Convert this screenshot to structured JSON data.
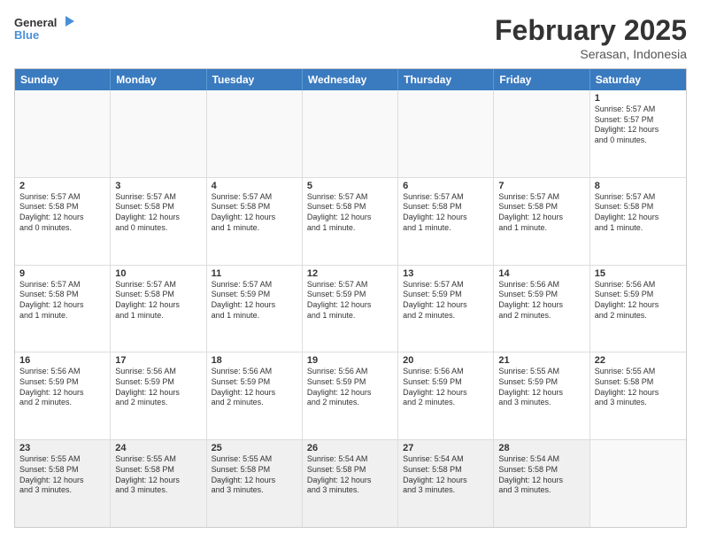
{
  "logo": {
    "line1": "General",
    "line2": "Blue"
  },
  "title": "February 2025",
  "subtitle": "Serasan, Indonesia",
  "header_days": [
    "Sunday",
    "Monday",
    "Tuesday",
    "Wednesday",
    "Thursday",
    "Friday",
    "Saturday"
  ],
  "rows": [
    [
      {
        "day": "",
        "text": "",
        "empty": true
      },
      {
        "day": "",
        "text": "",
        "empty": true
      },
      {
        "day": "",
        "text": "",
        "empty": true
      },
      {
        "day": "",
        "text": "",
        "empty": true
      },
      {
        "day": "",
        "text": "",
        "empty": true
      },
      {
        "day": "",
        "text": "",
        "empty": true
      },
      {
        "day": "1",
        "text": "Sunrise: 5:57 AM\nSunset: 5:57 PM\nDaylight: 12 hours\nand 0 minutes.",
        "empty": false
      }
    ],
    [
      {
        "day": "2",
        "text": "Sunrise: 5:57 AM\nSunset: 5:58 PM\nDaylight: 12 hours\nand 0 minutes.",
        "empty": false
      },
      {
        "day": "3",
        "text": "Sunrise: 5:57 AM\nSunset: 5:58 PM\nDaylight: 12 hours\nand 0 minutes.",
        "empty": false
      },
      {
        "day": "4",
        "text": "Sunrise: 5:57 AM\nSunset: 5:58 PM\nDaylight: 12 hours\nand 1 minute.",
        "empty": false
      },
      {
        "day": "5",
        "text": "Sunrise: 5:57 AM\nSunset: 5:58 PM\nDaylight: 12 hours\nand 1 minute.",
        "empty": false
      },
      {
        "day": "6",
        "text": "Sunrise: 5:57 AM\nSunset: 5:58 PM\nDaylight: 12 hours\nand 1 minute.",
        "empty": false
      },
      {
        "day": "7",
        "text": "Sunrise: 5:57 AM\nSunset: 5:58 PM\nDaylight: 12 hours\nand 1 minute.",
        "empty": false
      },
      {
        "day": "8",
        "text": "Sunrise: 5:57 AM\nSunset: 5:58 PM\nDaylight: 12 hours\nand 1 minute.",
        "empty": false
      }
    ],
    [
      {
        "day": "9",
        "text": "Sunrise: 5:57 AM\nSunset: 5:58 PM\nDaylight: 12 hours\nand 1 minute.",
        "empty": false
      },
      {
        "day": "10",
        "text": "Sunrise: 5:57 AM\nSunset: 5:58 PM\nDaylight: 12 hours\nand 1 minute.",
        "empty": false
      },
      {
        "day": "11",
        "text": "Sunrise: 5:57 AM\nSunset: 5:59 PM\nDaylight: 12 hours\nand 1 minute.",
        "empty": false
      },
      {
        "day": "12",
        "text": "Sunrise: 5:57 AM\nSunset: 5:59 PM\nDaylight: 12 hours\nand 1 minute.",
        "empty": false
      },
      {
        "day": "13",
        "text": "Sunrise: 5:57 AM\nSunset: 5:59 PM\nDaylight: 12 hours\nand 2 minutes.",
        "empty": false
      },
      {
        "day": "14",
        "text": "Sunrise: 5:56 AM\nSunset: 5:59 PM\nDaylight: 12 hours\nand 2 minutes.",
        "empty": false
      },
      {
        "day": "15",
        "text": "Sunrise: 5:56 AM\nSunset: 5:59 PM\nDaylight: 12 hours\nand 2 minutes.",
        "empty": false
      }
    ],
    [
      {
        "day": "16",
        "text": "Sunrise: 5:56 AM\nSunset: 5:59 PM\nDaylight: 12 hours\nand 2 minutes.",
        "empty": false
      },
      {
        "day": "17",
        "text": "Sunrise: 5:56 AM\nSunset: 5:59 PM\nDaylight: 12 hours\nand 2 minutes.",
        "empty": false
      },
      {
        "day": "18",
        "text": "Sunrise: 5:56 AM\nSunset: 5:59 PM\nDaylight: 12 hours\nand 2 minutes.",
        "empty": false
      },
      {
        "day": "19",
        "text": "Sunrise: 5:56 AM\nSunset: 5:59 PM\nDaylight: 12 hours\nand 2 minutes.",
        "empty": false
      },
      {
        "day": "20",
        "text": "Sunrise: 5:56 AM\nSunset: 5:59 PM\nDaylight: 12 hours\nand 2 minutes.",
        "empty": false
      },
      {
        "day": "21",
        "text": "Sunrise: 5:55 AM\nSunset: 5:59 PM\nDaylight: 12 hours\nand 3 minutes.",
        "empty": false
      },
      {
        "day": "22",
        "text": "Sunrise: 5:55 AM\nSunset: 5:58 PM\nDaylight: 12 hours\nand 3 minutes.",
        "empty": false
      }
    ],
    [
      {
        "day": "23",
        "text": "Sunrise: 5:55 AM\nSunset: 5:58 PM\nDaylight: 12 hours\nand 3 minutes.",
        "empty": false
      },
      {
        "day": "24",
        "text": "Sunrise: 5:55 AM\nSunset: 5:58 PM\nDaylight: 12 hours\nand 3 minutes.",
        "empty": false
      },
      {
        "day": "25",
        "text": "Sunrise: 5:55 AM\nSunset: 5:58 PM\nDaylight: 12 hours\nand 3 minutes.",
        "empty": false
      },
      {
        "day": "26",
        "text": "Sunrise: 5:54 AM\nSunset: 5:58 PM\nDaylight: 12 hours\nand 3 minutes.",
        "empty": false
      },
      {
        "day": "27",
        "text": "Sunrise: 5:54 AM\nSunset: 5:58 PM\nDaylight: 12 hours\nand 3 minutes.",
        "empty": false
      },
      {
        "day": "28",
        "text": "Sunrise: 5:54 AM\nSunset: 5:58 PM\nDaylight: 12 hours\nand 3 minutes.",
        "empty": false
      },
      {
        "day": "",
        "text": "",
        "empty": true
      }
    ]
  ]
}
